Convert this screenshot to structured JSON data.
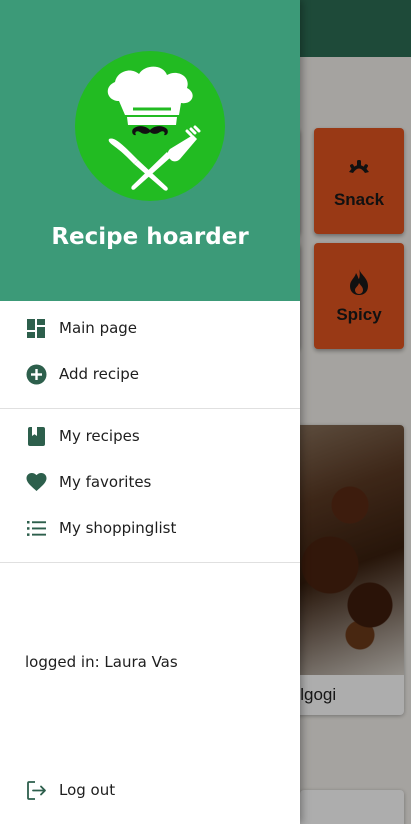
{
  "drawer": {
    "app_title": "Recipe hoarder",
    "nav_primary": [
      {
        "label": "Main page",
        "icon": "dashboard-icon"
      },
      {
        "label": "Add recipe",
        "icon": "add-circle-icon"
      }
    ],
    "nav_personal": [
      {
        "label": "My recipes",
        "icon": "book-icon"
      },
      {
        "label": "My favorites",
        "icon": "heart-icon"
      },
      {
        "label": "My shoppinglist",
        "icon": "list-icon"
      }
    ],
    "logged_in_text": "logged in: Laura Vas",
    "logout_label": "Log out"
  },
  "background": {
    "categories": [
      {
        "label": "Snack",
        "icon": "croissant-icon"
      },
      {
        "label": "Spicy",
        "icon": "flame-icon"
      }
    ],
    "recipe_card_title": "f Bulgogi"
  },
  "colors": {
    "header_green": "#3c9a78",
    "logo_green": "#22bb22",
    "icon_green": "#2d5f4c",
    "tile_orange": "#e2541f"
  }
}
